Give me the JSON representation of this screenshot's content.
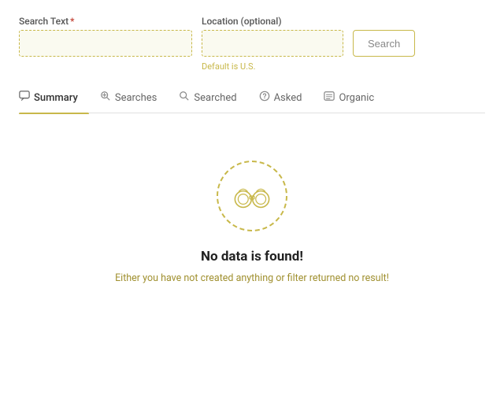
{
  "form": {
    "search_text_label": "Search Text",
    "search_text_required": "*",
    "search_text_placeholder": "",
    "location_label": "Location (optional)",
    "location_placeholder": "",
    "location_hint": "Default is U.S.",
    "search_button_label": "Search"
  },
  "tabs": [
    {
      "id": "summary",
      "label": "Summary",
      "icon": "chat",
      "active": true
    },
    {
      "id": "searches",
      "label": "Searches",
      "icon": "search-loop",
      "active": false
    },
    {
      "id": "searched",
      "label": "Searched",
      "icon": "magnify",
      "active": false
    },
    {
      "id": "asked",
      "label": "Asked",
      "icon": "question",
      "active": false
    },
    {
      "id": "organic",
      "label": "Organic",
      "icon": "list",
      "active": false
    }
  ],
  "empty_state": {
    "title": "No data is found!",
    "subtitle": "Either you have not created anything or filter returned no result!"
  }
}
